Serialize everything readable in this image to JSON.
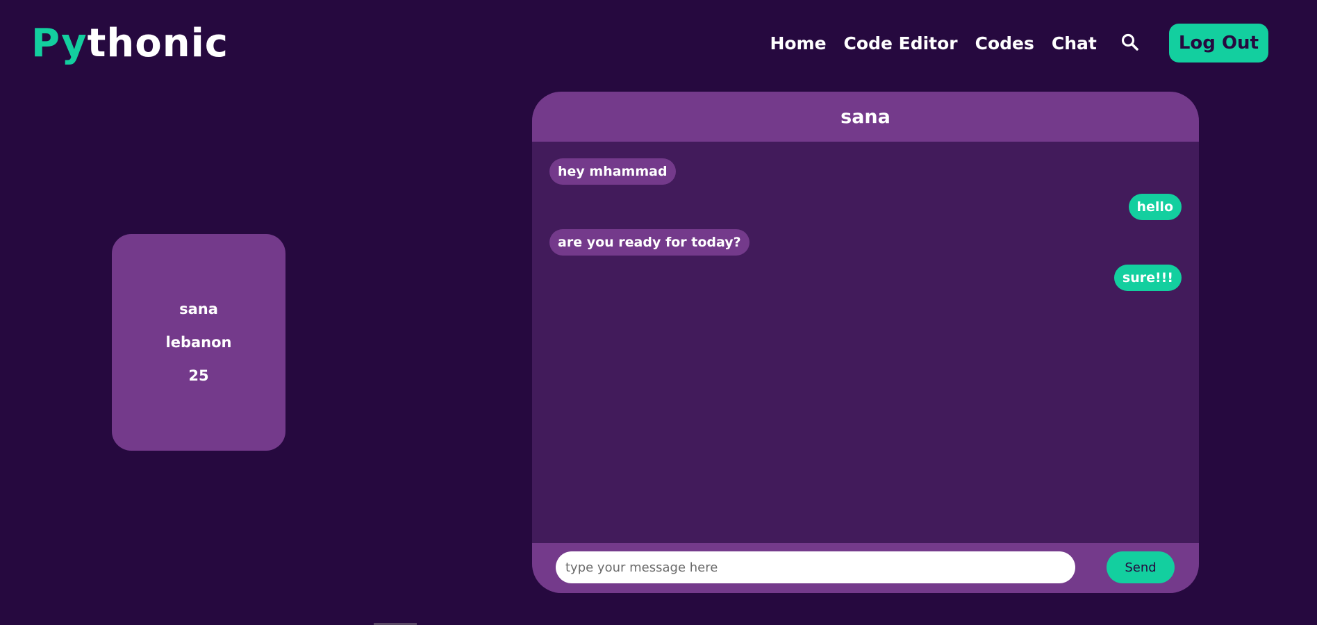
{
  "brand": {
    "accent_part": "Py",
    "rest_part": "thonic",
    "accent_color": "#13cf9f"
  },
  "nav": {
    "links": [
      "Home",
      "Code Editor",
      "Codes",
      "Chat"
    ],
    "search_icon": "search-icon",
    "logout_label": "Log Out"
  },
  "profile": {
    "name": "sana",
    "country": "lebanon",
    "age": "25"
  },
  "chat": {
    "contact_name": "sana",
    "messages": [
      {
        "direction": "received",
        "text": "hey mhammad"
      },
      {
        "direction": "sent",
        "text": "hello"
      },
      {
        "direction": "received",
        "text": "are you ready for today?"
      },
      {
        "direction": "sent",
        "text": "sure!!!"
      }
    ],
    "input_placeholder": "type your message here",
    "input_value": "",
    "send_label": "Send"
  },
  "colors": {
    "background": "#26093f",
    "panel": "#743a8b",
    "chat_body": "#421b5b",
    "accent": "#13cf9f"
  }
}
